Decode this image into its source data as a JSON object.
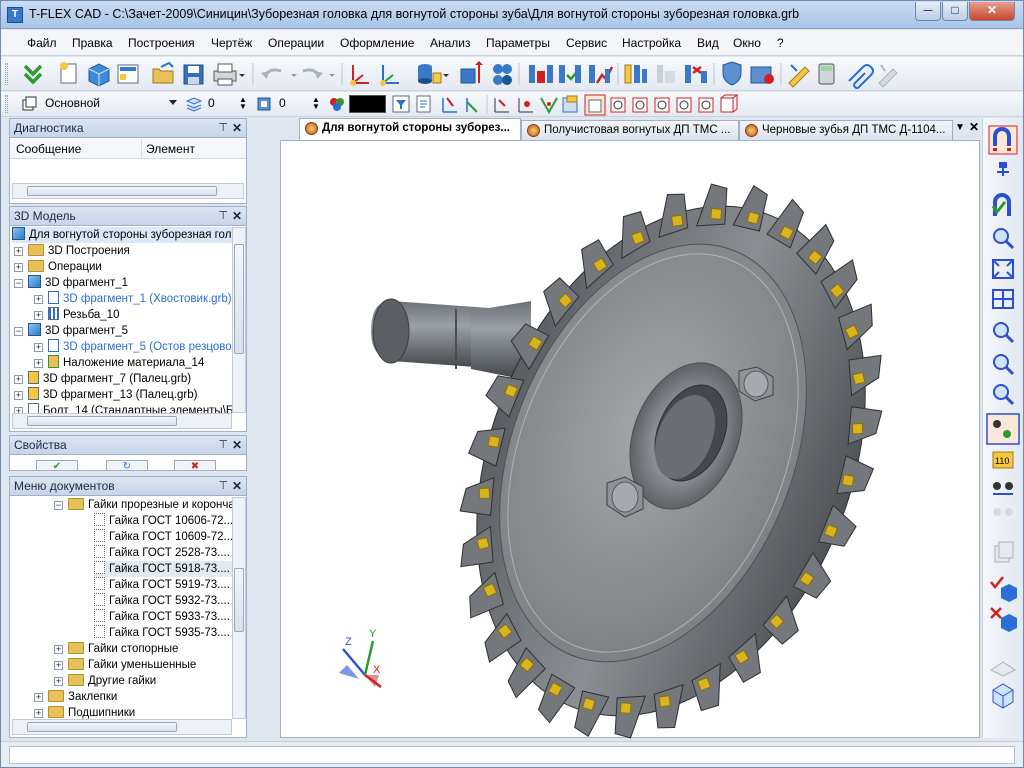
{
  "window": {
    "title": "T-FLEX CAD - C:\\Зачет-2009\\Синицин\\Зуборезная головка для вогнутой стороны зуба\\Для вогнутой стороны зуборезная головка.grb",
    "minimize": "─",
    "maximize": "□",
    "close": "✕"
  },
  "menu": [
    "Файл",
    "Правка",
    "Построения",
    "Чертёж",
    "Операции",
    "Оформление",
    "Анализ",
    "Параметры",
    "Сервис",
    "Настройка",
    "Вид",
    "Окно",
    "?"
  ],
  "toolbar2": {
    "layer_value": "Основной",
    "level_value": "0",
    "priority_value": "0",
    "color_value": "#000000"
  },
  "diagnostics": {
    "title": "Диагностика",
    "col_message": "Сообщение",
    "col_element": "Элемент"
  },
  "model3d": {
    "title": "3D Модель",
    "root": "Для вогнутой стороны зуборезная голо",
    "items": [
      "3D Построения",
      "Операции",
      "3D фрагмент_1",
      "3D фрагмент_1 (Хвостовик.grb)",
      "Резьба_10",
      "3D фрагмент_5",
      "3D фрагмент_5 (Остов резцово",
      "Наложение материала_14",
      "3D фрагмент_7 (Палец.grb)",
      "3D фрагмент_13 (Палец.grb)",
      "Болт_14 (Стандартные элементы\\Б"
    ]
  },
  "properties": {
    "title": "Свойства",
    "ok": "✔",
    "refresh": "↻",
    "cancel": "✖"
  },
  "docmenu": {
    "title": "Меню документов",
    "group": "Гайки прорезные и корончa",
    "items": [
      "Гайка ГОСТ 10606-72....",
      "Гайка ГОСТ 10609-72....",
      "Гайка ГОСТ 2528-73....",
      "Гайка ГОСТ 5918-73....",
      "Гайка ГОСТ 5919-73....",
      "Гайка ГОСТ 5932-73....",
      "Гайка ГОСТ 5933-73....",
      "Гайка ГОСТ 5935-73...."
    ],
    "subgroups": [
      "Гайки стопорные",
      "Гайки уменьшенные",
      "Другие гайки"
    ],
    "top": [
      "Заклепки",
      "Подшипники"
    ]
  },
  "tabs": [
    "Для вогнутой стороны зуборез...",
    "Получистовая вогнутых ДП ТМС ...",
    "Черновые зубья ДП ТМС Д-1104..."
  ],
  "axes": {
    "z": "Z",
    "y": "Y",
    "x": "X"
  },
  "status_text": "",
  "colors": {
    "accent": "#3a78c8",
    "teeth": "#d9b41d",
    "body": "#7d7f83"
  }
}
